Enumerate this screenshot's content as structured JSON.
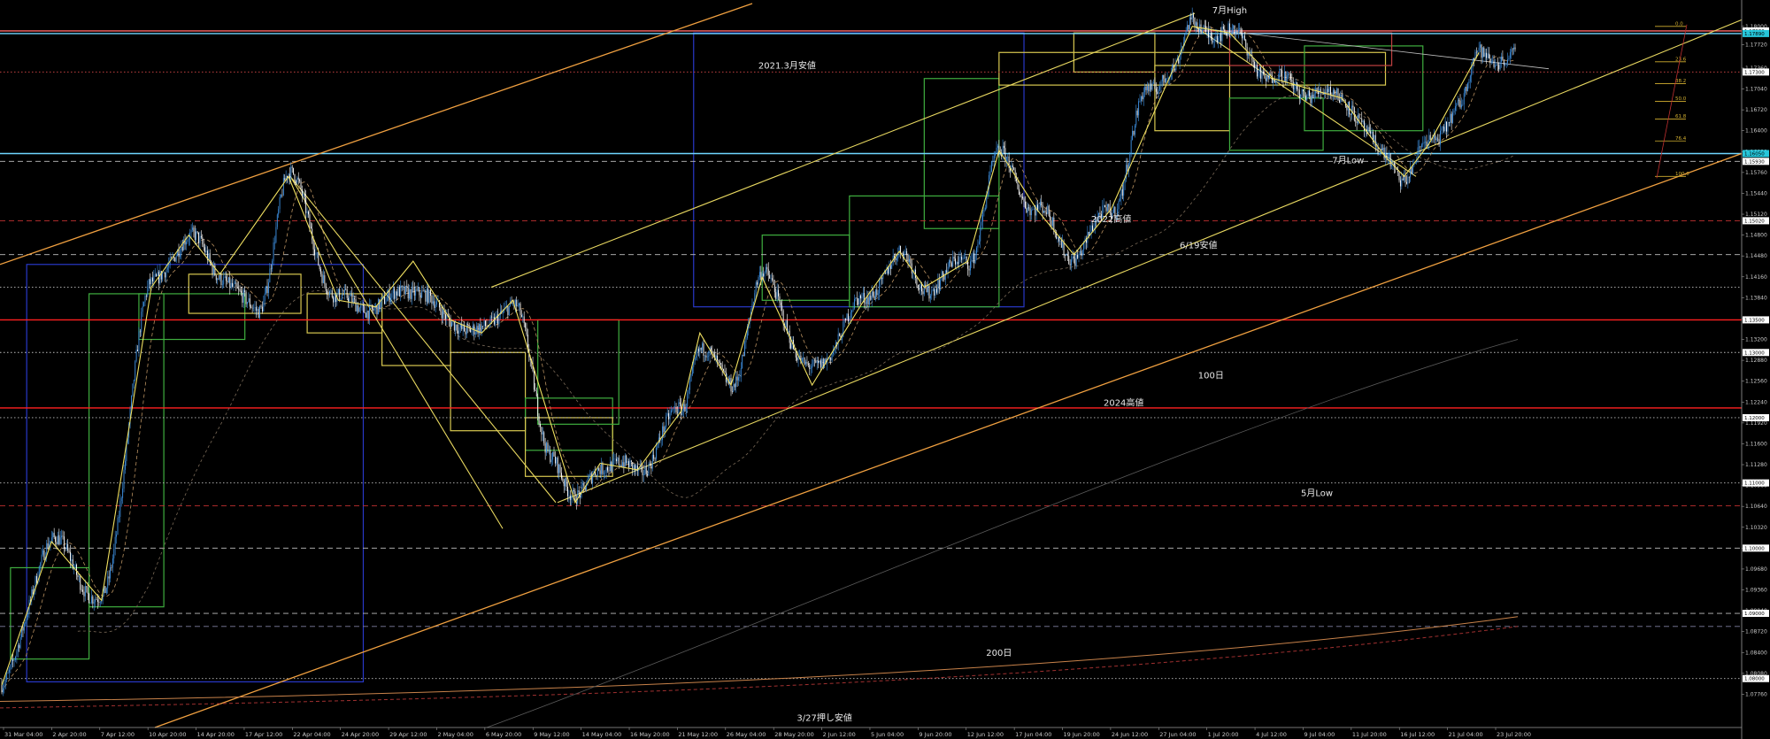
{
  "chart_data": {
    "type": "candlestick",
    "y_range": [
      1.0725,
      1.1835
    ],
    "y_ticks": [
      "1.18000",
      "1.17720",
      "1.17360",
      "1.17040",
      "1.16720",
      "1.16400",
      "1.16080",
      "1.15760",
      "1.15440",
      "1.15120",
      "1.14800",
      "1.14480",
      "1.14160",
      "1.13840",
      "1.13520",
      "1.13200",
      "1.12880",
      "1.12560",
      "1.12240",
      "1.11920",
      "1.11600",
      "1.11280",
      "1.10960",
      "1.10640",
      "1.10320",
      "1.10000",
      "1.09680",
      "1.09360",
      "1.09040",
      "1.08720",
      "1.08400",
      "1.08080",
      "1.07760"
    ],
    "y_badges": [
      {
        "value": 1.1793,
        "text": "1.17930",
        "color": "#ffffff"
      },
      {
        "value": 1.1789,
        "text": "1.17890",
        "color": "#26c6da"
      },
      {
        "value": 1.173,
        "text": "1.17300",
        "color": "#ffffff"
      },
      {
        "value": 1.1605,
        "text": "1.16050",
        "color": "#26c6da"
      },
      {
        "value": 1.1593,
        "text": "1.15930",
        "color": "#ffffff"
      },
      {
        "value": 1.1502,
        "text": "1.15020",
        "color": "#ffffff"
      },
      {
        "value": 1.135,
        "text": "1.13500",
        "color": "#ffffff"
      },
      {
        "value": 1.13,
        "text": "1.13000",
        "color": "#ffffff"
      },
      {
        "value": 1.12,
        "text": "1.12000",
        "color": "#ffffff"
      },
      {
        "value": 1.11,
        "text": "1.11000",
        "color": "#ffffff"
      },
      {
        "value": 1.1,
        "text": "1.10000",
        "color": "#ffffff"
      },
      {
        "value": 1.09,
        "text": "1.09000",
        "color": "#ffffff"
      },
      {
        "value": 1.08,
        "text": "1.08000",
        "color": "#ffffff"
      }
    ],
    "x_ticks": [
      "31 Mar 04:00",
      "2 Apr 20:00",
      "7 Apr 12:00",
      "10 Apr 20:00",
      "14 Apr 20:00",
      "17 Apr 12:00",
      "22 Apr 04:00",
      "24 Apr 20:00",
      "29 Apr 12:00",
      "2 May 04:00",
      "6 May 20:00",
      "9 May 12:00",
      "14 May 04:00",
      "16 May 20:00",
      "21 May 12:00",
      "26 May 04:00",
      "28 May 20:00",
      "2 Jun 12:00",
      "5 Jun 04:00",
      "9 Jun 20:00",
      "12 Jun 12:00",
      "17 Jun 04:00",
      "19 Jun 20:00",
      "24 Jun 12:00",
      "27 Jun 04:00",
      "1 Jul 20:00",
      "4 Jul 12:00",
      "9 Jul 04:00",
      "11 Jul 20:00",
      "16 Jul 12:00",
      "21 Jul 04:00",
      "23 Jul 20:00"
    ],
    "key_points": [
      {
        "i": 0,
        "v": 1.079
      },
      {
        "i": 40,
        "v": 1.101
      },
      {
        "i": 80,
        "v": 1.092
      },
      {
        "i": 120,
        "v": 1.14
      },
      {
        "i": 150,
        "v": 1.148
      },
      {
        "i": 175,
        "v": 1.142
      },
      {
        "i": 205,
        "v": 1.136
      },
      {
        "i": 230,
        "v": 1.157
      },
      {
        "i": 270,
        "v": 1.138
      },
      {
        "i": 300,
        "v": 1.137
      },
      {
        "i": 330,
        "v": 1.14
      },
      {
        "i": 360,
        "v": 1.135
      },
      {
        "i": 385,
        "v": 1.133
      },
      {
        "i": 410,
        "v": 1.138
      },
      {
        "i": 440,
        "v": 1.115
      },
      {
        "i": 460,
        "v": 1.107
      },
      {
        "i": 480,
        "v": 1.113
      },
      {
        "i": 510,
        "v": 1.112
      },
      {
        "i": 545,
        "v": 1.121
      },
      {
        "i": 560,
        "v": 1.131
      },
      {
        "i": 585,
        "v": 1.125
      },
      {
        "i": 610,
        "v": 1.1415
      },
      {
        "i": 650,
        "v": 1.127
      },
      {
        "i": 690,
        "v": 1.1375
      },
      {
        "i": 720,
        "v": 1.145
      },
      {
        "i": 740,
        "v": 1.14
      },
      {
        "i": 775,
        "v": 1.144
      },
      {
        "i": 800,
        "v": 1.16
      },
      {
        "i": 830,
        "v": 1.152
      },
      {
        "i": 860,
        "v": 1.145
      },
      {
        "i": 890,
        "v": 1.152
      },
      {
        "i": 920,
        "v": 1.17
      },
      {
        "i": 940,
        "v": 1.174
      },
      {
        "i": 955,
        "v": 1.18
      },
      {
        "i": 985,
        "v": 1.179
      },
      {
        "i": 1020,
        "v": 1.172
      },
      {
        "i": 1050,
        "v": 1.17
      },
      {
        "i": 1075,
        "v": 1.169
      },
      {
        "i": 1110,
        "v": 1.16
      },
      {
        "i": 1125,
        "v": 1.157
      },
      {
        "i": 1145,
        "v": 1.162
      },
      {
        "i": 1170,
        "v": 1.168
      },
      {
        "i": 1185,
        "v": 1.176
      },
      {
        "i": 1205,
        "v": 1.175
      }
    ],
    "horizontal_levels": [
      {
        "value": 1.1793,
        "color": "#ff6a6a",
        "style": "solid"
      },
      {
        "value": 1.1789,
        "color": "#6fd6ff",
        "style": "solid"
      },
      {
        "value": 1.173,
        "color": "#c04040",
        "style": "dotted"
      },
      {
        "value": 1.1605,
        "color": "#6fd6ff",
        "style": "solid"
      },
      {
        "value": 1.1593,
        "color": "#c0c0c0",
        "style": "dashed"
      },
      {
        "value": 1.1502,
        "color": "#c03030",
        "style": "dashed"
      },
      {
        "value": 1.145,
        "color": "#c0c0c0",
        "style": "dashed"
      },
      {
        "value": 1.14,
        "color": "#c0c0c0",
        "style": "dotted"
      },
      {
        "value": 1.135,
        "color": "#ff2020",
        "style": "solid"
      },
      {
        "value": 1.13,
        "color": "#c0c0c0",
        "style": "dotted"
      },
      {
        "value": 1.1215,
        "color": "#ff2020",
        "style": "solid"
      },
      {
        "value": 1.12,
        "color": "#c0c0c0",
        "style": "dotted"
      },
      {
        "value": 1.11,
        "color": "#c0c0c0",
        "style": "dotted"
      },
      {
        "value": 1.1065,
        "color": "#c03030",
        "style": "dashed"
      },
      {
        "value": 1.1,
        "color": "#c0c0c0",
        "style": "dashed"
      },
      {
        "value": 1.09,
        "color": "#c0c0c0",
        "style": "dashed"
      },
      {
        "value": 1.088,
        "color": "#8080a0",
        "style": "dashed"
      },
      {
        "value": 1.08,
        "color": "#c0c0c0",
        "style": "dotted"
      }
    ],
    "annotations": [
      {
        "text": "7月High",
        "i": 985,
        "v": 1.182
      },
      {
        "text": "2021.3月安値",
        "i": 630,
        "v": 1.1735
      },
      {
        "text": "7月Low",
        "i": 1080,
        "v": 1.159
      },
      {
        "text": "2022高値",
        "i": 890,
        "v": 1.15
      },
      {
        "text": "6/19安値",
        "i": 960,
        "v": 1.146
      },
      {
        "text": "100日",
        "i": 970,
        "v": 1.126
      },
      {
        "text": "2024高値",
        "i": 900,
        "v": 1.1218
      },
      {
        "text": "5月Low",
        "i": 1055,
        "v": 1.108
      },
      {
        "text": "200日",
        "i": 800,
        "v": 1.0835
      },
      {
        "text": "3/27押し安値",
        "i": 660,
        "v": 1.0735
      }
    ],
    "fib_levels": [
      "0.0",
      "23.6",
      "38.2",
      "50.0",
      "61.8",
      "76.4",
      "100.0"
    ],
    "fib_range": {
      "high": 1.18,
      "low": 1.157
    },
    "legend": "none",
    "grid": false
  }
}
